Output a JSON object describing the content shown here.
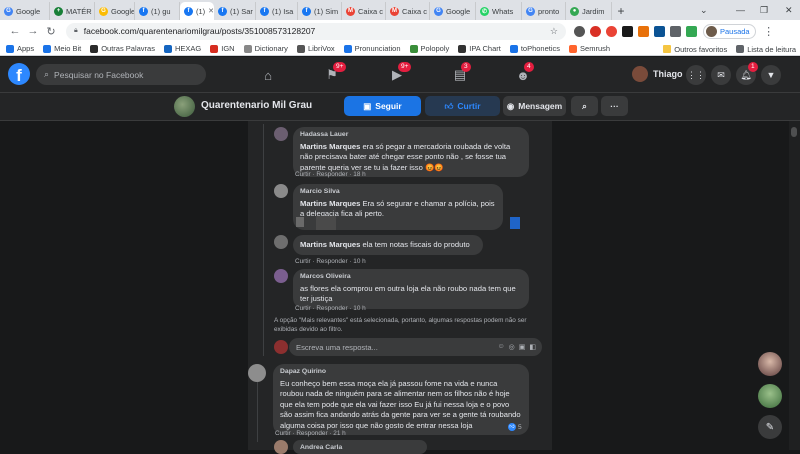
{
  "browser": {
    "tabs": [
      {
        "label": "Google",
        "icon": "google-icon",
        "color": "#4285f4",
        "glyph": "G"
      },
      {
        "label": "MATÉR",
        "icon": "sheets-icon",
        "color": "#188038",
        "glyph": "+"
      },
      {
        "label": "Google",
        "icon": "google-icon",
        "color": "#fbbc04",
        "glyph": "G"
      },
      {
        "label": "(1) gu",
        "icon": "facebook-icon",
        "color": "#1877f2",
        "glyph": "f"
      },
      {
        "label": "(1)",
        "icon": "facebook-icon",
        "color": "#1877f2",
        "glyph": "f",
        "active": true
      },
      {
        "label": "(1) Sar",
        "icon": "facebook-icon",
        "color": "#1877f2",
        "glyph": "f"
      },
      {
        "label": "(1) Isa",
        "icon": "facebook-icon",
        "color": "#1877f2",
        "glyph": "f"
      },
      {
        "label": "(1) Sim",
        "icon": "facebook-icon",
        "color": "#1877f2",
        "glyph": "f"
      },
      {
        "label": "Caixa c",
        "icon": "gmail-icon",
        "color": "#ea4335",
        "glyph": "M"
      },
      {
        "label": "Caixa c",
        "icon": "gmail-icon",
        "color": "#ea4335",
        "glyph": "M"
      },
      {
        "label": "Google",
        "icon": "google-icon",
        "color": "#4285f4",
        "glyph": "G"
      },
      {
        "label": "Whats",
        "icon": "whatsapp-icon",
        "color": "#25d366",
        "glyph": "✆"
      },
      {
        "label": "pronto",
        "icon": "google-icon",
        "color": "#4285f4",
        "glyph": "G"
      },
      {
        "label": "Jardim",
        "icon": "maps-icon",
        "color": "#34a853",
        "glyph": "●"
      }
    ],
    "url": "facebook.com/quarentenariomilgrau/posts/351008573128207",
    "profile_label": "Pausada",
    "bookmarks": [
      {
        "label": "Apps",
        "icon": "apps-grid-icon",
        "color": "#1a73e8"
      },
      {
        "label": "Meio Bit",
        "icon": "meiobit-icon",
        "color": "#1a73e8"
      },
      {
        "label": "Outras Palavras",
        "icon": "outras-palavras-icon",
        "color": "#2b2b2b"
      },
      {
        "label": "HEXAG",
        "icon": "hexag-icon",
        "color": "#1565c0"
      },
      {
        "label": "IGN",
        "icon": "ign-icon",
        "color": "#d62d20"
      },
      {
        "label": "Dictionary",
        "icon": "dictionary-icon",
        "color": "#888888"
      },
      {
        "label": "LibriVox",
        "icon": "librivox-icon",
        "color": "#555555"
      },
      {
        "label": "Pronunciation",
        "icon": "pronunciation-icon",
        "color": "#1a73e8"
      },
      {
        "label": "Polopoly",
        "icon": "polopoly-icon",
        "color": "#3a8e3a"
      },
      {
        "label": "IPA Chart",
        "icon": "ipa-chart-icon",
        "color": "#333333"
      },
      {
        "label": "toPhonetics",
        "icon": "tophonetics-icon",
        "color": "#1a73e8"
      },
      {
        "label": "Semrush",
        "icon": "semrush-icon",
        "color": "#ff642d"
      }
    ],
    "folder_other": "Outros favoritos",
    "reading_list": "Lista de leitura"
  },
  "fb": {
    "search_placeholder": "Pesquisar no Facebook",
    "badges": {
      "pages": "9+",
      "watch": "9+",
      "marketplace": "3",
      "groups": "4",
      "notifications": "1"
    },
    "user_name": "Thiago",
    "page_name": "Quarentenario Mil Grau",
    "follow_label": "Seguir",
    "like_label": "Curtir",
    "message_label": "Mensagem"
  },
  "comments": [
    {
      "author": "Hadassa Lauer",
      "tag": "Martins Marques",
      "text": " era só pegar a mercadoria roubada de volta não precisava bater até chegar esse ponto não , se fosse tua parente queria ver se tu ia fazer isso 😡😡",
      "like": "Curtir",
      "reply": "Responder",
      "time": "18 h"
    },
    {
      "author": "Marcio Silva",
      "tag": "Martins Marques",
      "text": " Era só segurar e chamar a polícia, pois a delegacia fica ali perto."
    },
    {
      "author": "",
      "tag": "Martins Marques",
      "text": " ela tem notas fiscais do produto",
      "like": "Curtir",
      "reply": "Responder",
      "time": "10 h"
    },
    {
      "author": "Marcos Oliveira",
      "text": "as flores ela comprou em outra loja ela não roubo nada tem que ter justiça",
      "like": "Curtir",
      "reply": "Responder",
      "time": "10 h"
    },
    {
      "author": "Dapaz Quirino",
      "text": "Eu conheço bem essa moça ela já passou fome na vida e nunca roubou nada de ninguém para se alimentar nem os filhos não é hoje que ela tem pode que ela vai fazer isso Eu já fui nessa loja e o povo são assim fica andando atrás da gente para ver se a gente tá roubando alguma coisa por isso que não gosto de entrar nessa loja",
      "like": "Curtir",
      "reply": "Responder",
      "time": "21 h",
      "reactions": "5"
    },
    {
      "author": "Andrea Carla"
    }
  ],
  "notice": "A opção \"Mais relevantes\" está selecionada, portanto, algumas respostas podem não ser exibidas devido ao filtro.",
  "reply_placeholder": "Escreva uma resposta...",
  "colors": {
    "fb_blue": "#2d88ff",
    "button_blue": "#1b74e4",
    "dark_bg": "#18191a",
    "card": "#242526",
    "bubble": "#3a3b3c",
    "badge_red": "#e41e3f"
  }
}
